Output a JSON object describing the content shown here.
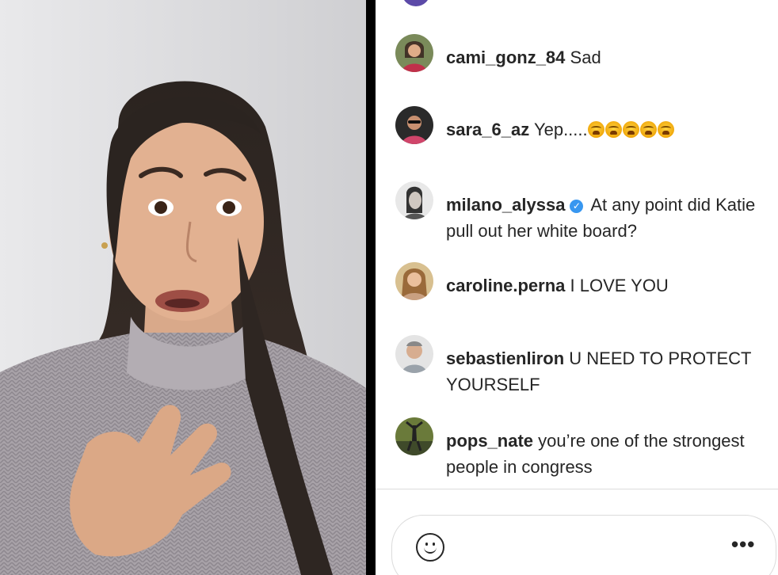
{
  "comments": [
    {
      "username": "cami_gonz_84",
      "text": "Sad",
      "verified": false
    },
    {
      "username": "sara_6_az",
      "text": "Yep.....",
      "verified": false,
      "emoji_count": 5
    },
    {
      "username": "milano_alyssa",
      "text": "At any point did Katie pull out her white board?",
      "verified": true
    },
    {
      "username": "caroline.perna",
      "text": "I LOVE YOU",
      "verified": false
    },
    {
      "username": "sebastienliron",
      "text": "U NEED TO PROTECT YOURSELF",
      "verified": false
    },
    {
      "username": "pops_nate",
      "text": "you’re one of the strongest people in congress",
      "verified": false
    }
  ],
  "composer": {
    "emoji_icon": "smiley-icon",
    "more_icon": "more-options-icon",
    "more_label": "•••"
  },
  "colors": {
    "text": "#262626",
    "verified": "#3897f0",
    "divider": "#000000",
    "border": "#dbdbdb"
  }
}
